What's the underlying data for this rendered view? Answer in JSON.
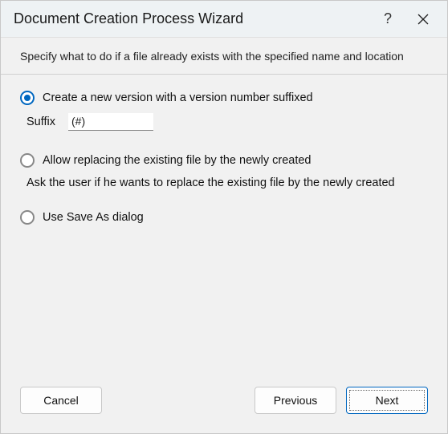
{
  "titlebar": {
    "title": "Document Creation Process Wizard",
    "help_icon": "help-icon",
    "close_icon": "close-icon"
  },
  "subheader": {
    "text": "Specify what to do if a file already exists with the specified name and location"
  },
  "options": {
    "opt1": {
      "label": "Create a new version with a version number suffixed",
      "selected": true,
      "suffix_label": "Suffix",
      "suffix_value": "(#)"
    },
    "opt2": {
      "label": "Allow replacing the existing file by the newly created",
      "selected": false,
      "description": "Ask the user if he wants to replace the existing file by the newly created"
    },
    "opt3": {
      "label": "Use Save As dialog",
      "selected": false
    }
  },
  "buttons": {
    "cancel": "Cancel",
    "previous": "Previous",
    "next": "Next"
  }
}
